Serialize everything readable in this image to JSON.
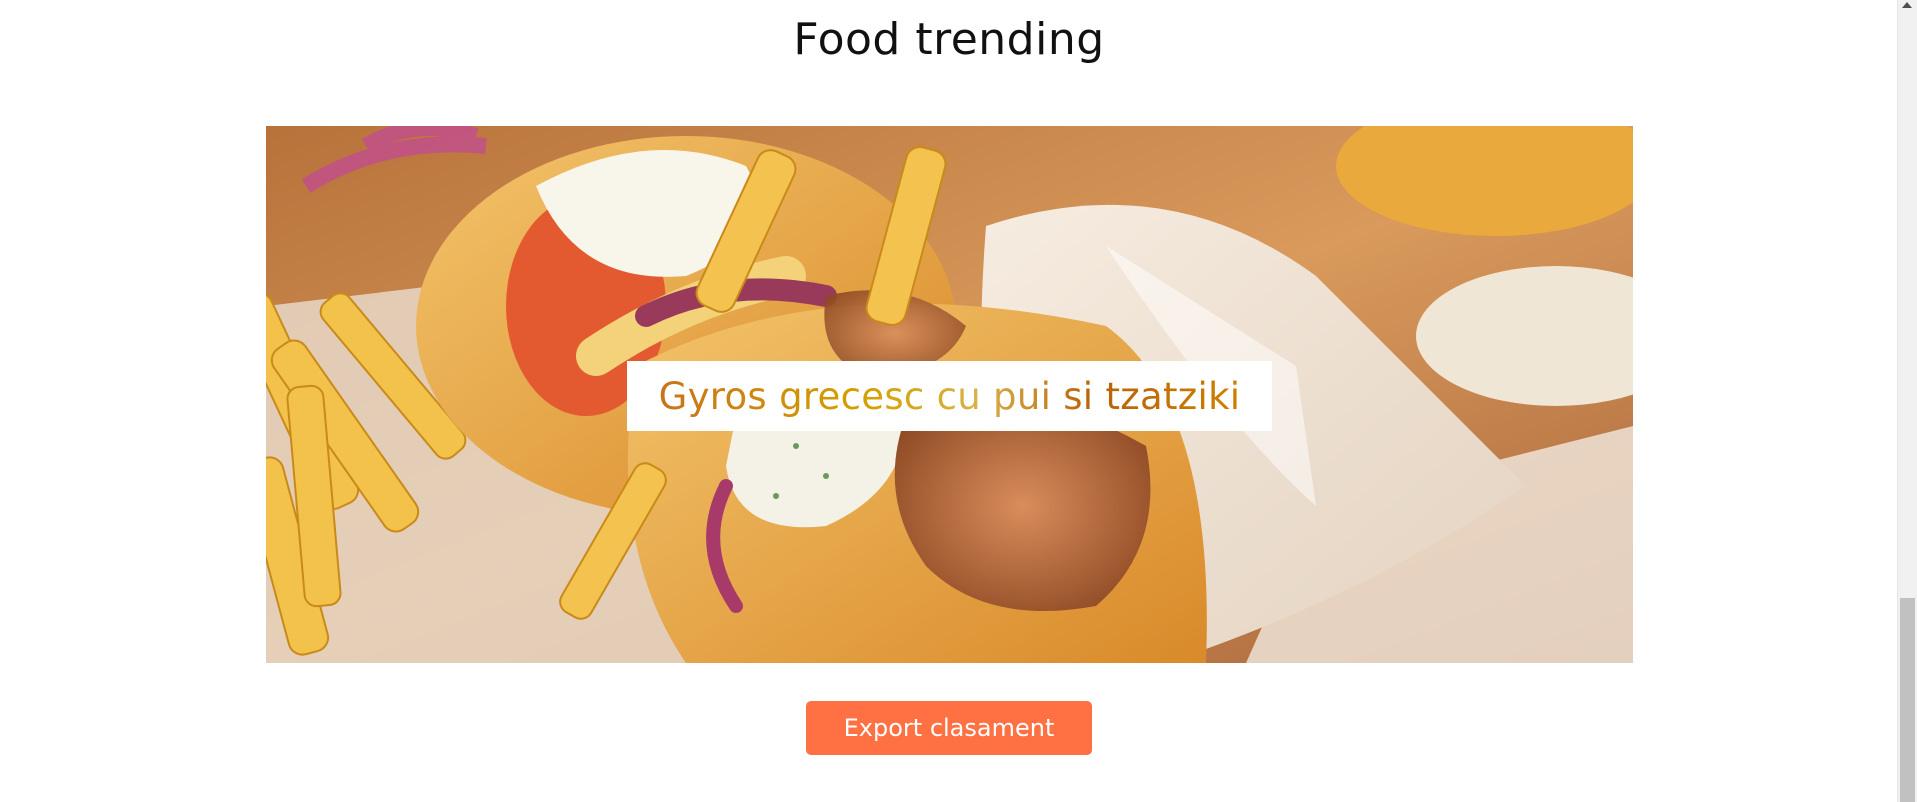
{
  "section": {
    "title": "Food trending"
  },
  "featured": {
    "image_alt": "Gyros wrap with chicken, tzatziki, onion and fries",
    "caption": "Gyros grecesc cu pui si tzatziki"
  },
  "actions": {
    "export_label": "Export clasament"
  },
  "colors": {
    "accent": "#ff7043",
    "caption_gold": "#d4a000",
    "caption_orange": "#c9731a"
  }
}
